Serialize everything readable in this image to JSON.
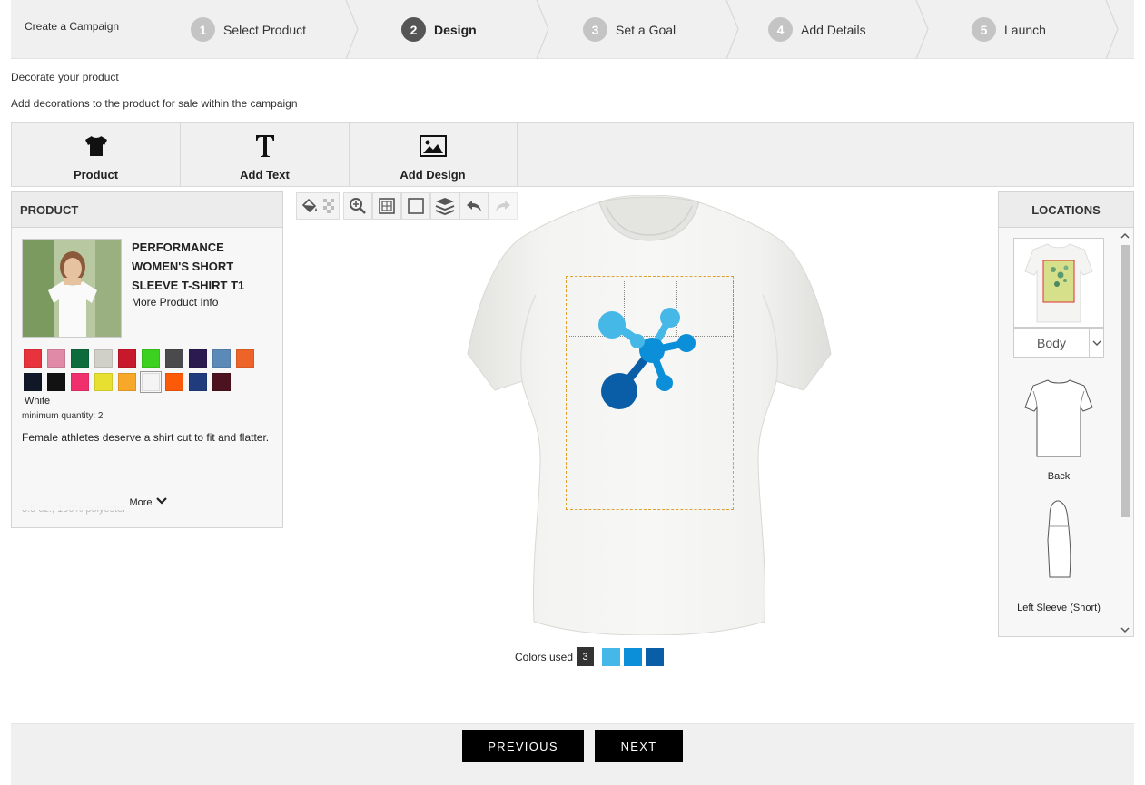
{
  "wizard": {
    "title": "Create a Campaign",
    "steps": [
      {
        "num": "1",
        "label": "Select Product",
        "active": false
      },
      {
        "num": "2",
        "label": "Design",
        "active": true
      },
      {
        "num": "3",
        "label": "Set a Goal",
        "active": false
      },
      {
        "num": "4",
        "label": "Add Details",
        "active": false
      },
      {
        "num": "5",
        "label": "Launch",
        "active": false
      }
    ]
  },
  "intro": {
    "heading": "Decorate your product",
    "subheading": "Add decorations to the product for sale within the campaign"
  },
  "tools": [
    {
      "label": "Product",
      "icon": "tshirt-icon"
    },
    {
      "label": "Add Text",
      "icon": "text-icon"
    },
    {
      "label": "Add Design",
      "icon": "image-icon"
    }
  ],
  "product": {
    "header": "PRODUCT",
    "name": "Performance Women's Short Sleeve T-Shirt T1",
    "more_info": "More Product Info",
    "swatches": [
      "#e8323c",
      "#e08aa8",
      "#0e6b3c",
      "#d0d0c8",
      "#c8182c",
      "#3cd020",
      "#4a4a4c",
      "#2a1a50",
      "#5b8ab8",
      "#ee6428",
      "#101828",
      "#121212",
      "#f0306c",
      "#e8e030",
      "#f8a828",
      "#f4f4f4",
      "#fc5a08",
      "#203c7c",
      "#4c1220"
    ],
    "selected_swatch": 15,
    "color_name": "White",
    "min_qty": "minimum quantity: 2",
    "description": "Female athletes deserve a shirt cut to fit and flatter.",
    "more": "More",
    "spec": "3.5 oz., 100% polyester"
  },
  "editor": {
    "toolbar": [
      "paint-bucket-icon",
      "checker-icon",
      "zoom-icon",
      "grid-icon",
      "frame-icon",
      "layers-icon",
      "undo-icon",
      "redo-icon"
    ],
    "colors_used_label": "Colors used",
    "colors_used_count": "3",
    "colors_used": [
      "#45b8e8",
      "#0b8fd8",
      "#0a5ea8"
    ],
    "design_colors": {
      "light": "#45b8e8",
      "mid": "#0b8fd8",
      "dark": "#0a5ea8"
    }
  },
  "locations": {
    "header": "LOCATIONS",
    "items": [
      {
        "label": "Body",
        "type": "select"
      },
      {
        "label": "Back"
      },
      {
        "label": "Left Sleeve (Short)"
      }
    ]
  },
  "footer": {
    "previous": "PREVIOUS",
    "next": "NEXT"
  }
}
